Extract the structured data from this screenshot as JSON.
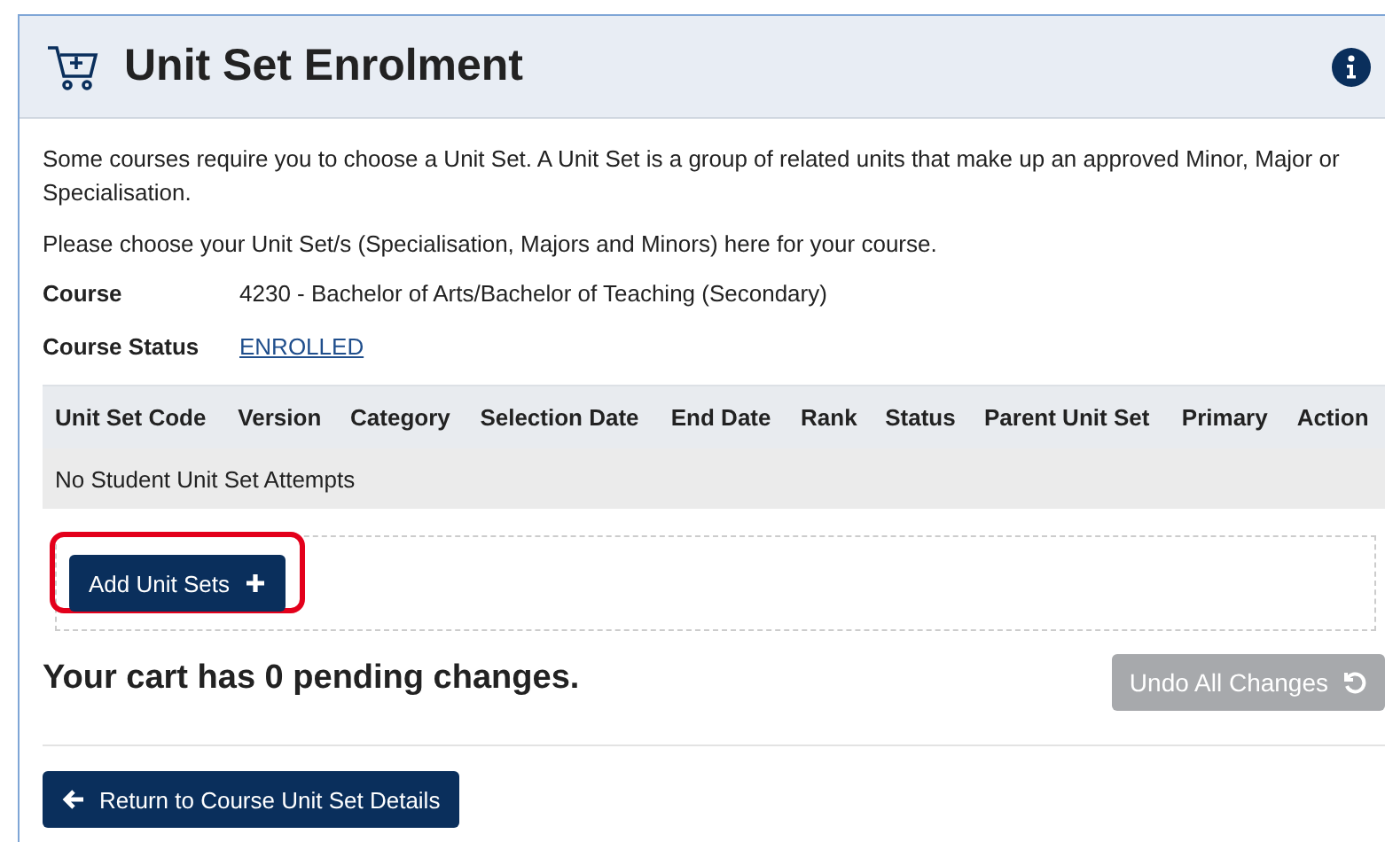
{
  "header": {
    "title": "Unit Set Enrolment"
  },
  "intro": [
    "Some courses require you to choose a Unit Set. A Unit Set is a group of related units that make up an approved Minor, Major or Specialisation.",
    "Please choose your Unit Set/s (Specialisation, Majors and Minors) here for your course."
  ],
  "details": [
    {
      "label": "Course",
      "value": "4230 - Bachelor of Arts/Bachelor of Teaching (Secondary)",
      "kind": "text"
    },
    {
      "label": "Course Status",
      "value": "ENROLLED",
      "kind": "link"
    }
  ],
  "table": {
    "columns": [
      "Unit Set Code",
      "Version",
      "Category",
      "Selection Date",
      "End Date",
      "Rank",
      "Status",
      "Parent Unit Set",
      "Primary",
      "Action"
    ],
    "empty_message": "No Student Unit Set Attempts"
  },
  "add_button": {
    "label": "Add Unit Sets",
    "highlighted": true
  },
  "cart": {
    "message": "Your cart has 0 pending changes.",
    "undo_button": {
      "label": "Undo All Changes",
      "disabled": true
    }
  },
  "return_button": {
    "label": "Return to Course Unit Set Details"
  }
}
